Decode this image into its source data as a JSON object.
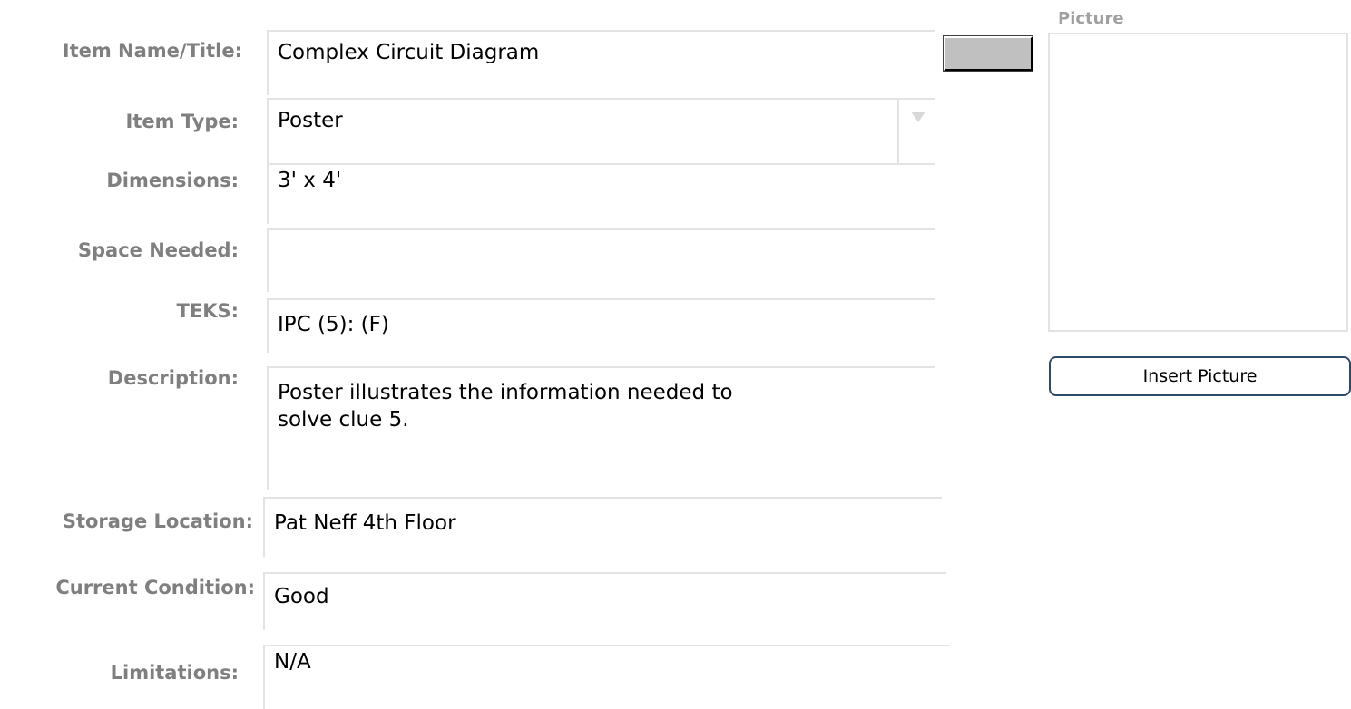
{
  "form": {
    "labels": {
      "item_name": "Item Name/Title:",
      "item_type": "Item Type:",
      "dimensions": "Dimensions:",
      "space_needed": "Space Needed:",
      "teks": "TEKS:",
      "description": "Description:",
      "storage_location": "Storage Location:",
      "current_condition": "Current Condition:",
      "limitations": "Limitations:"
    },
    "values": {
      "item_name": "Complex Circuit Diagram",
      "item_type": "Poster",
      "dimensions": "3' x 4'",
      "space_needed": "",
      "teks": "IPC (5): (F)",
      "description": "Poster illustrates the information needed to\nsolve clue 5.",
      "storage_location": "Pat Neff 4th Floor",
      "current_condition": "Good",
      "limitations": "N/A"
    }
  },
  "picture": {
    "title": "Picture",
    "insert_label": "Insert Picture"
  }
}
